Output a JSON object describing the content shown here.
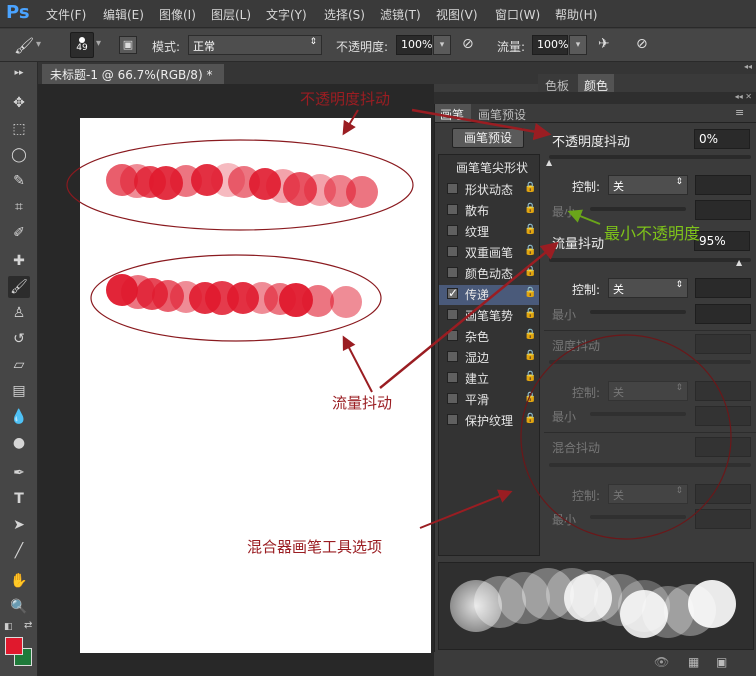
{
  "app": {
    "logo": "Ps"
  },
  "menu": [
    "文件(F)",
    "编辑(E)",
    "图像(I)",
    "图层(L)",
    "文字(Y)",
    "选择(S)",
    "滤镜(T)",
    "视图(V)",
    "窗口(W)",
    "帮助(H)"
  ],
  "options": {
    "brush_size": "49",
    "mode_label": "模式:",
    "mode_value": "正常",
    "opacity_label": "不透明度:",
    "opacity_value": "100%",
    "flow_label": "流量:",
    "flow_value": "100%"
  },
  "document": {
    "tab_title": "未标题-1 @ 66.7%(RGB/8) *",
    "close": "×"
  },
  "color_panel": {
    "tab1": "色板",
    "tab2": "颜色"
  },
  "brush_panel": {
    "tab_brush": "画笔",
    "tab_presets": "画笔预设",
    "preset_button": "画笔预设",
    "tip_shape": "画笔笔尖形状",
    "items": [
      {
        "label": "形状动态",
        "checked": false
      },
      {
        "label": "散布",
        "checked": false
      },
      {
        "label": "纹理",
        "checked": false
      },
      {
        "label": "双重画笔",
        "checked": false
      },
      {
        "label": "颜色动态",
        "checked": false
      },
      {
        "label": "传递",
        "checked": true
      },
      {
        "label": "画笔笔势",
        "checked": false
      },
      {
        "label": "杂色",
        "checked": false
      },
      {
        "label": "湿边",
        "checked": false
      },
      {
        "label": "建立",
        "checked": false
      },
      {
        "label": "平滑",
        "checked": false
      },
      {
        "label": "保护纹理",
        "checked": false
      }
    ],
    "opacity_jitter_label": "不透明度抖动",
    "opacity_jitter_value": "0%",
    "control_label": "控制:",
    "control_value": "关",
    "min_label": "最小",
    "flow_jitter_label": "流量抖动",
    "flow_jitter_value": "95%",
    "wetness_jitter_label": "湿度抖动",
    "mix_jitter_label": "混合抖动"
  },
  "annotations": {
    "opacity_jitter": "不透明度抖动",
    "min_opacity": "最小不透明度",
    "flow_jitter": "流量抖动",
    "mixer_options": "混合器画笔工具选项"
  },
  "colors": {
    "foreground": "#e0192d",
    "background": "#1f7a3a",
    "annotation": "#9a1d22",
    "min_opacity_annotation": "#7ec31a"
  }
}
